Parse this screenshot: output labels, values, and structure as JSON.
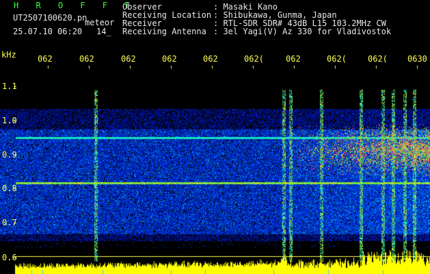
{
  "header": {
    "app_title": "H R O F F T",
    "file_name": "UT2507100620.pn",
    "file_suffix": "meteor",
    "timestamp": "25.07.10 06:20",
    "count": "14_",
    "info": [
      {
        "label": "Observer",
        "value": ": Masaki Kano"
      },
      {
        "label": "Receiving Location",
        "value": ": Shibukawa, Gunma, Japan"
      },
      {
        "label": "Receiver",
        "value": ": RTL-SDR SDR# 43dB L15 103.2MHz CW"
      },
      {
        "label": "Receiving Antenna",
        "value": ": 3el Yagi(V) Az 330 for Vladivostok"
      }
    ]
  },
  "colors": {
    "background": "#000000",
    "header_text": "#e8e8e8",
    "title": "#3cff3c",
    "axis": "#ffff55",
    "noise": "#1020c0",
    "echo": "#ff3399"
  },
  "chart_data": {
    "type": "heatmap",
    "y_unit_label": "kHz",
    "y_ticks": [
      "1.1",
      "1.0",
      "0.9",
      "0.8",
      "0.7",
      "0.6"
    ],
    "x_ticks": [
      "062",
      "062",
      "062",
      "062",
      "062",
      "062(",
      "062",
      "062(",
      "062(",
      "0630"
    ],
    "ylim": [
      0.6,
      1.15
    ],
    "carrier_lines_khz": [
      0.96,
      0.83
    ],
    "echo_band_khz": [
      0.87,
      0.94
    ],
    "grid": false
  }
}
